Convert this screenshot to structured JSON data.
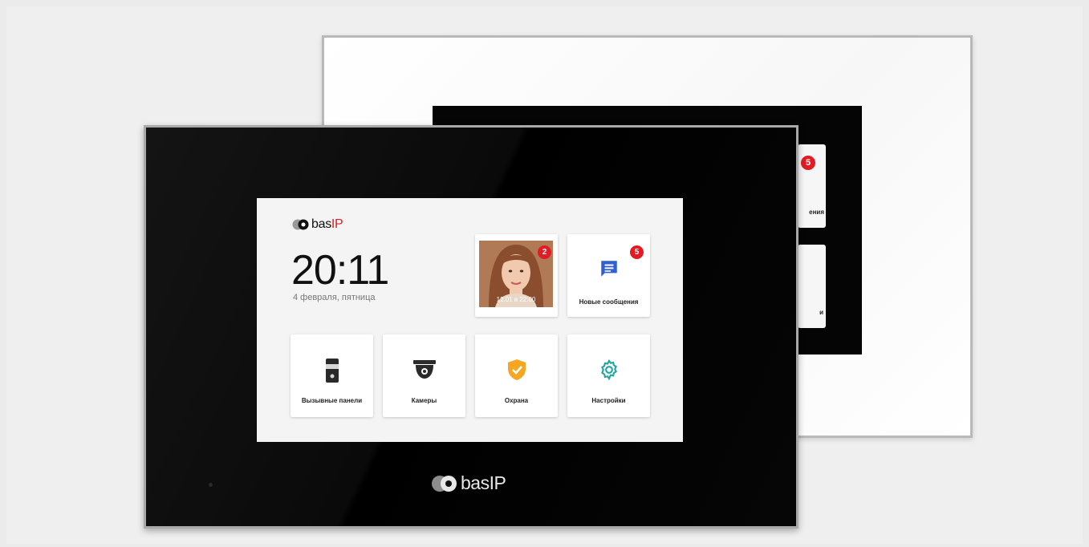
{
  "brand": {
    "name": "bas",
    "suffix": "IP"
  },
  "home": {
    "time": "20:11",
    "date": "4 февраля, пятница"
  },
  "tiles": {
    "missed_call": {
      "badge": "2",
      "timestamp": "12.01 в 22:00"
    },
    "messages": {
      "label": "Новые сообщения",
      "badge": "5"
    },
    "call_panels": {
      "label": "Вызывные панели"
    },
    "cameras": {
      "label": "Камеры"
    },
    "security": {
      "label": "Охрана"
    },
    "settings": {
      "label": "Настройки"
    }
  },
  "back_device": {
    "messages_badge": "5",
    "messages_label_fragment": "ения",
    "second_label_fragment": "и"
  },
  "colors": {
    "accent_red": "#e31b23",
    "messages_blue": "#2f5fd0",
    "security_orange": "#f5a623",
    "settings_teal": "#1fa79e"
  }
}
